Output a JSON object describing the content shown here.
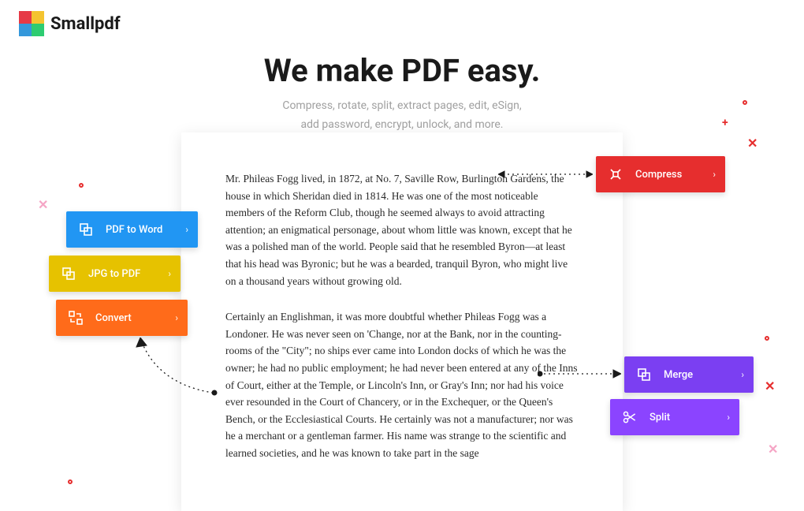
{
  "brand": "Smallpdf",
  "hero": {
    "title": "We make PDF easy.",
    "subtitle_line1": "Compress, rotate, split, extract pages, edit, eSign,",
    "subtitle_line2": "add password, encrypt, unlock, and more."
  },
  "document": {
    "para1": "Mr. Phileas Fogg lived, in 1872, at No. 7, Saville Row, Burlington Gardens, the house in which Sheridan died in 1814. He was one of the most noticeable members of the Reform Club, though he seemed always to avoid attracting attention; an enigmatical personage, about whom little was known, except that he was a polished man of the world. People said that he resembled Byron—at least that his head was Byronic; but he was a bearded, tranquil Byron, who might live on a thousand years without growing old.",
    "para2": "Certainly an Englishman, it was more doubtful whether Phileas Fogg was a Londoner. He was never seen on 'Change, nor at the Bank, nor in the counting-rooms of the \"City\"; no ships ever came into London docks of which he was the owner; he had no public employment; he had never been entered at any of the Inns of Court, either at the Temple, or Lincoln's Inn, or Gray's Inn; nor had his voice ever resounded in the Court of Chancery, or in the Exchequer, or the Queen's Bench, or the Ecclesiastical Courts. He certainly was not a manufacturer; nor was he a merchant or a gentleman farmer. His name was strange to the scientific and learned societies, and he was known to take part in the sage"
  },
  "tools": {
    "compress": "Compress",
    "pdf_to_word": "PDF to Word",
    "jpg_to_pdf": "JPG to PDF",
    "convert": "Convert",
    "merge": "Merge",
    "split": "Split"
  },
  "colors": {
    "compress": "#e62e2e",
    "pdf_to_word": "#2196f3",
    "jpg_to_pdf": "#e6c200",
    "convert": "#ff6b1a",
    "merge": "#7b3ff2",
    "split": "#8b44ff"
  }
}
